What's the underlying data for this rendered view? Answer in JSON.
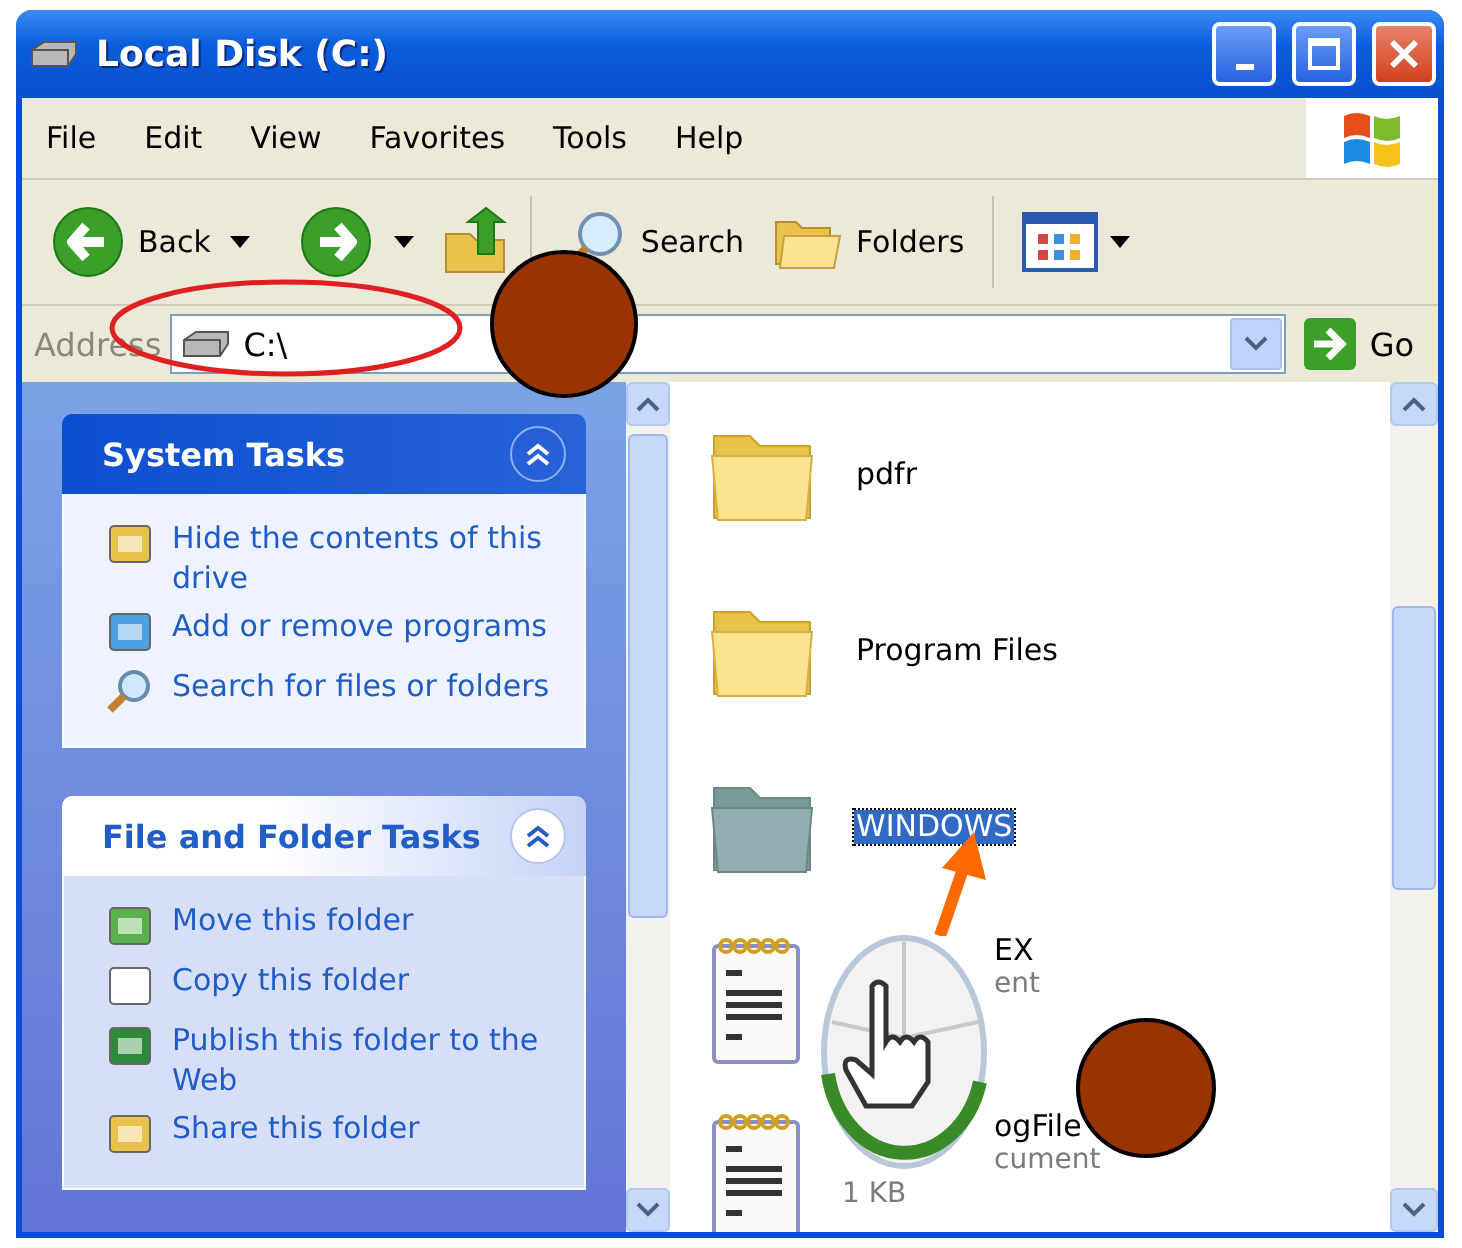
{
  "window": {
    "title": "Local Disk (C:)"
  },
  "menu": [
    "File",
    "Edit",
    "View",
    "Favorites",
    "Tools",
    "Help"
  ],
  "toolbar": {
    "back": "Back",
    "search": "Search",
    "folders": "Folders"
  },
  "address": {
    "label": "Address",
    "value": "C:\\",
    "go": "Go"
  },
  "task_panels": [
    {
      "title": "System Tasks",
      "kind": "special",
      "expanded": true,
      "links": [
        "Hide the contents of this drive",
        "Add or remove programs",
        "Search for files or folders"
      ]
    },
    {
      "title": "File and Folder Tasks",
      "kind": "normal",
      "expanded": true,
      "links": [
        "Move this folder",
        "Copy this folder",
        "Publish this folder to the Web",
        "Share this folder"
      ]
    }
  ],
  "files": [
    {
      "kind": "folder",
      "selected": false,
      "name": "pdfr"
    },
    {
      "kind": "folder",
      "selected": false,
      "name": "Program Files"
    },
    {
      "kind": "folder",
      "selected": true,
      "name": "WINDOWS"
    },
    {
      "kind": "document",
      "selected": false,
      "name": "EX",
      "type": "ent"
    },
    {
      "kind": "document",
      "selected": false,
      "name": "ogFile",
      "type": "cument",
      "size": "1 KB"
    }
  ]
}
